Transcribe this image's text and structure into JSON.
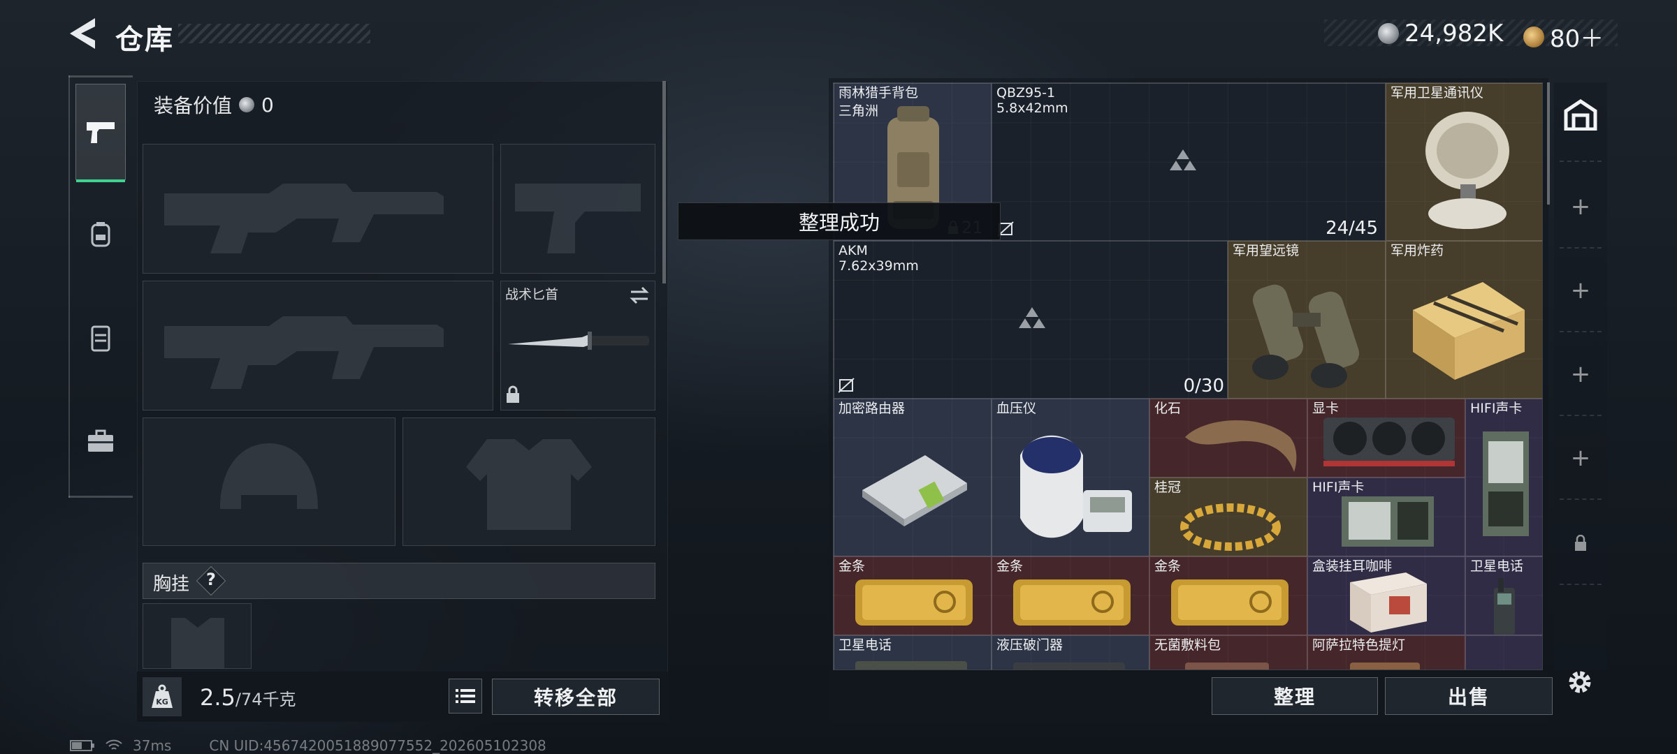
{
  "header": {
    "title": "仓库",
    "silver_amount": "24,982K",
    "gold_amount": "80＋"
  },
  "loadout": {
    "equip_value_label": "装备价值",
    "equip_value": "0",
    "melee_label": "战术匕首",
    "rig_label": "胸挂",
    "rig_help": "?",
    "weight_value": "2.5",
    "weight_max": "/74千克",
    "transfer_all_label": "转移全部"
  },
  "stash": {
    "items": [
      {
        "name": "雨林猎手背包",
        "sub": "三角洲"
      },
      {
        "name": "QBZ95-1",
        "sub": "5.8x42mm",
        "count": "24/45",
        "lock_count": "21"
      },
      {
        "name": "军用卫星通讯仪"
      },
      {
        "name": "AKM",
        "sub": "7.62x39mm",
        "count": "0/30"
      },
      {
        "name": "军用望远镜"
      },
      {
        "name": "军用炸药"
      },
      {
        "name": "加密路由器"
      },
      {
        "name": "血压仪"
      },
      {
        "name": "化石"
      },
      {
        "name": "显卡"
      },
      {
        "name": "HIFI声卡"
      },
      {
        "name": "桂冠"
      },
      {
        "name": "HIFI声卡"
      },
      {
        "name": "金条"
      },
      {
        "name": "金条"
      },
      {
        "name": "金条"
      },
      {
        "name": "盒装挂耳咖啡"
      },
      {
        "name": "卫星电话"
      },
      {
        "name": "卫星电话"
      },
      {
        "name": "液压破门器"
      },
      {
        "name": "无菌敷料包"
      },
      {
        "name": "阿萨拉特色提灯"
      }
    ],
    "sort_label": "整理",
    "sell_label": "出售"
  },
  "toast": {
    "message": "整理成功"
  },
  "status": {
    "ping": "37ms",
    "uid": "CN UID:4567420051889077552_202605102308"
  },
  "colors": {
    "accent_green": "#3fd38f",
    "gold_coin": "#c99a4e",
    "silver_coin": "#9aa0a6"
  }
}
